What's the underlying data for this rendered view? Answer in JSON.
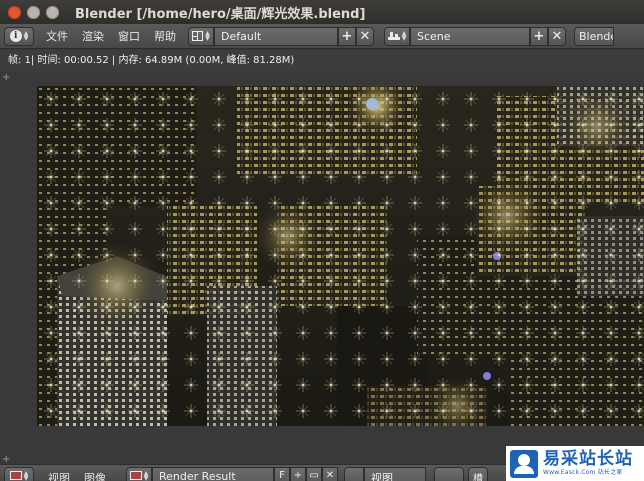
{
  "window": {
    "title": "Blender [/home/hero/桌面/辉光效果.blend]"
  },
  "header": {
    "menus": [
      "文件",
      "渲染",
      "窗口",
      "帮助"
    ],
    "layout_value": "Default",
    "scene_value": "Scene",
    "engine_value": "Blender Render"
  },
  "infobar": {
    "text": "帧: 1| 时间: 00:00.52 | 内存: 64.89M (0.00M, 峰值: 81.28M)"
  },
  "footer": {
    "menus": [
      "视图",
      "图像"
    ],
    "image_value": "Render Result",
    "fake_user": "F",
    "view_value": "视图",
    "slot_label": "槽"
  },
  "watermark": {
    "main": "易采站长站",
    "sub": "Www.Easck.Com 站长之家"
  },
  "colors": {
    "titlebar": "#3a3935",
    "header": "#505050",
    "background": "#393939",
    "close_button": "#e4572e"
  }
}
